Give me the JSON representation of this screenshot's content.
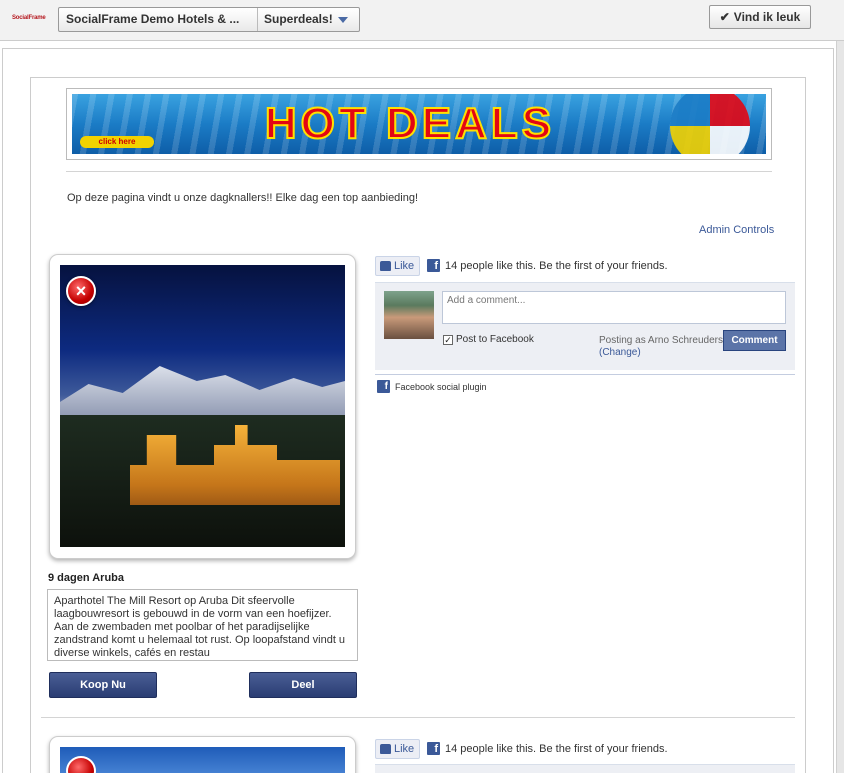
{
  "topbar": {
    "logo": "SocialFrame",
    "page_name": "SocialFrame Demo Hotels & ...",
    "tab_label": "Superdeals!",
    "like_page_label": "Vind ik leuk",
    "like_page_check": "✔"
  },
  "banner": {
    "headline": "HOT DEALS",
    "click_here": "click here"
  },
  "intro_text": "Op deze pagina vindt u onze dagknallers!! Elke dag een top aanbieding!",
  "admin_controls": "Admin Controls",
  "deals": [
    {
      "title": "9 dagen Aruba",
      "description": "Aparthotel The Mill Resort op Aruba Dit sfeervolle laagbouwresort is gebouwd in de vorm van een hoefijzer. Aan de zwembaden met poolbar of het paradijselijke zandstrand komt u helemaal tot rust. Op loopafstand vindt u diverse winkels, cafés en restau",
      "buy_label": "Koop Nu",
      "share_label": "Deel"
    }
  ],
  "facebook": {
    "like_label": "Like",
    "like_count_text": "14 people like this. Be the first of your friends.",
    "comment_placeholder": "Add a comment...",
    "post_to_facebook": "Post to Facebook",
    "posting_as": "Posting as Arno Schreuders",
    "change_label": "(Change)",
    "comment_button": "Comment",
    "social_plugin": "Facebook social plugin",
    "fb_glyph": "f"
  },
  "icons": {
    "close": "close-icon",
    "like": "thumbs-up-icon",
    "facebook": "facebook-icon",
    "dropdown": "chevron-down-icon"
  },
  "colors": {
    "facebook_blue": "#3b5998",
    "button_dark": "#2a3d73",
    "banner_red": "#e30613",
    "banner_yellow": "#ffe000"
  }
}
